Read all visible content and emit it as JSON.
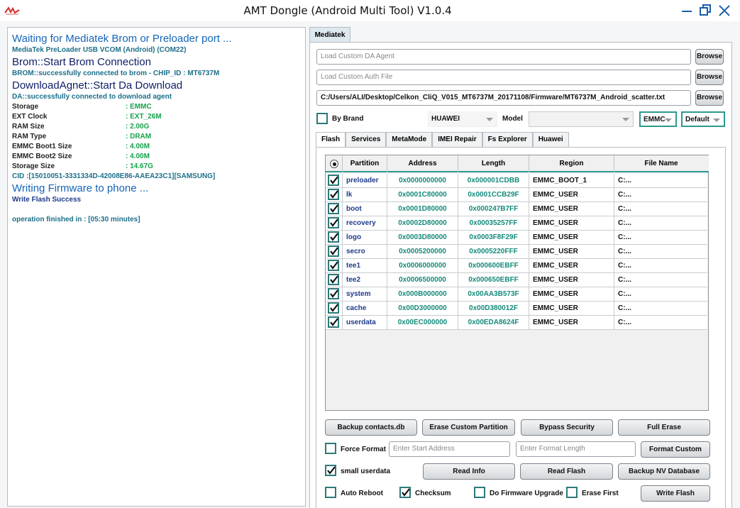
{
  "window": {
    "title": "AMT Dongle (Android Multi Tool) V1.0.4"
  },
  "log": {
    "lines": [
      {
        "text": "Waiting for Mediatek Brom or Preloader port ...",
        "style": "big"
      },
      {
        "text": "MediaTek PreLoader USB VCOM (Android) (COM22)",
        "style": "small"
      },
      {
        "text": "Brom::Start Brom Connection",
        "style": "big-dark"
      },
      {
        "text": "BROM::successfully connected to brom - CHIP_ID : MT6737M",
        "style": "small"
      },
      {
        "text": "DownloadAgnet::Start Da Download",
        "style": "big-dark"
      },
      {
        "text": "DA::successfully connected to download agent",
        "style": "small"
      }
    ],
    "info": [
      {
        "key": "Storage",
        "value": ": EMMC"
      },
      {
        "key": "EXT Clock",
        "value": ": EXT_26M"
      },
      {
        "key": "RAM Size",
        "value": ": 2.00G"
      },
      {
        "key": "RAM Type",
        "value": ": DRAM"
      },
      {
        "key": "EMMC Boot1 Size",
        "value": ": 4.00M"
      },
      {
        "key": "EMMC Boot2 Size",
        "value": ": 4.00M"
      },
      {
        "key": "Storage Size",
        "value": ": 14.67G"
      }
    ],
    "cid": "CID :[15010051-3331334D-42008E86-AAEA23C1][SAMSUNG]",
    "writing": "Writing Firmware to phone ...",
    "write_success": "Write Flash Success",
    "finished": "operation finished in : [05:30 minutes]"
  },
  "main_tab": "Mediatek",
  "files": {
    "da_agent_placeholder": "Load Custom DA Agent",
    "auth_file_placeholder": "Load Custom Auth File",
    "scatter_path": "C:/Users/ALI/Desktop/Celkon_CliQ_V015_MT6737M_20171108/Firmware/MT6737M_Android_scatter.txt",
    "browse_label": "Browse"
  },
  "brand": {
    "by_brand_label": "By Brand",
    "brand_value": "HUAWEI",
    "model_label": "Model",
    "model_value": "",
    "storage_value": "EMMC",
    "mode_value": "Default"
  },
  "sub_tabs": [
    "Flash",
    "Services",
    "MetaMode",
    "IMEI Repair",
    "Fs Explorer",
    "Huawei"
  ],
  "table": {
    "headers": [
      "Partition",
      "Address",
      "Length",
      "Region",
      "File Name"
    ],
    "rows": [
      {
        "partition": "preloader",
        "address": "0x0000000000",
        "length": "0x000001CDBB",
        "region": "EMMC_BOOT_1",
        "file": "C:..."
      },
      {
        "partition": "lk",
        "address": "0x0001C80000",
        "length": "0x0001CCB29F",
        "region": "EMMC_USER",
        "file": "C:..."
      },
      {
        "partition": "boot",
        "address": "0x0001D80000",
        "length": "0x000247B7FF",
        "region": "EMMC_USER",
        "file": "C:..."
      },
      {
        "partition": "recovery",
        "address": "0x0002D80000",
        "length": "0x00035257FF",
        "region": "EMMC_USER",
        "file": "C:..."
      },
      {
        "partition": "logo",
        "address": "0x0003D80000",
        "length": "0x0003F8F29F",
        "region": "EMMC_USER",
        "file": "C:..."
      },
      {
        "partition": "secro",
        "address": "0x0005200000",
        "length": "0x0005220FFF",
        "region": "EMMC_USER",
        "file": "C:..."
      },
      {
        "partition": "tee1",
        "address": "0x0006000000",
        "length": "0x000600EBFF",
        "region": "EMMC_USER",
        "file": "C:..."
      },
      {
        "partition": "tee2",
        "address": "0x0006500000",
        "length": "0x000650EBFF",
        "region": "EMMC_USER",
        "file": "C:..."
      },
      {
        "partition": "system",
        "address": "0x000B000000",
        "length": "0x00AA3B573F",
        "region": "EMMC_USER",
        "file": "C:..."
      },
      {
        "partition": "cache",
        "address": "0x00D3000000",
        "length": "0x00D380012F",
        "region": "EMMC_USER",
        "file": "C:..."
      },
      {
        "partition": "userdata",
        "address": "0x00EC000000",
        "length": "0x00EDA8624F",
        "region": "EMMC_USER",
        "file": "C:..."
      }
    ]
  },
  "actions": {
    "backup_contacts": "Backup contacts.db",
    "erase_custom_partition": "Erase Custom Partition",
    "bypass_security": "Bypass Security",
    "full_erase": "Full Erase",
    "force_format": "Force Format",
    "start_address_placeholder": "Enter Start Address",
    "format_length_placeholder": "Enter Format Length",
    "format_custom": "Format Custom",
    "small_userdata": "small userdata",
    "read_info": "Read Info",
    "read_flash": "Read Flash",
    "backup_nv": "Backup NV Database",
    "auto_reboot": "Auto Reboot",
    "checksum": "Checksum",
    "do_firmware_upgrade": "Do Firmware Upgrade",
    "erase_first": "Erase First",
    "write_flash": "Write Flash"
  },
  "colors": {
    "accent_teal": "#2b9a8e",
    "log_blue": "#1565b8",
    "value_green": "#16a34a"
  }
}
